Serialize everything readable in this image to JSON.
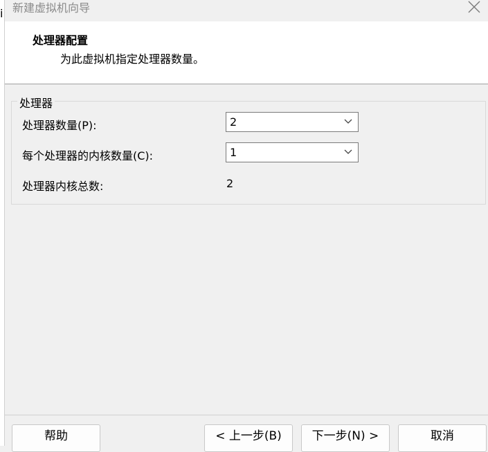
{
  "window": {
    "title": "新建虚拟机向导",
    "left_edge_glyph": "i"
  },
  "header": {
    "title": "处理器配置",
    "subtitle": "为此虚拟机指定处理器数量。"
  },
  "processor_group": {
    "legend": "处理器",
    "rows": [
      {
        "label": "处理器数量(P):",
        "value": "2"
      },
      {
        "label": "每个处理器的内核数量(C):",
        "value": "1"
      },
      {
        "label": "处理器内核总数:",
        "value": "2"
      }
    ]
  },
  "buttons": {
    "help": "帮助",
    "back": "< 上一步(B)",
    "next": "下一步(N) >",
    "cancel": "取消"
  },
  "icons": {
    "close": "close-icon",
    "dropdown": "chevron-down-icon"
  }
}
